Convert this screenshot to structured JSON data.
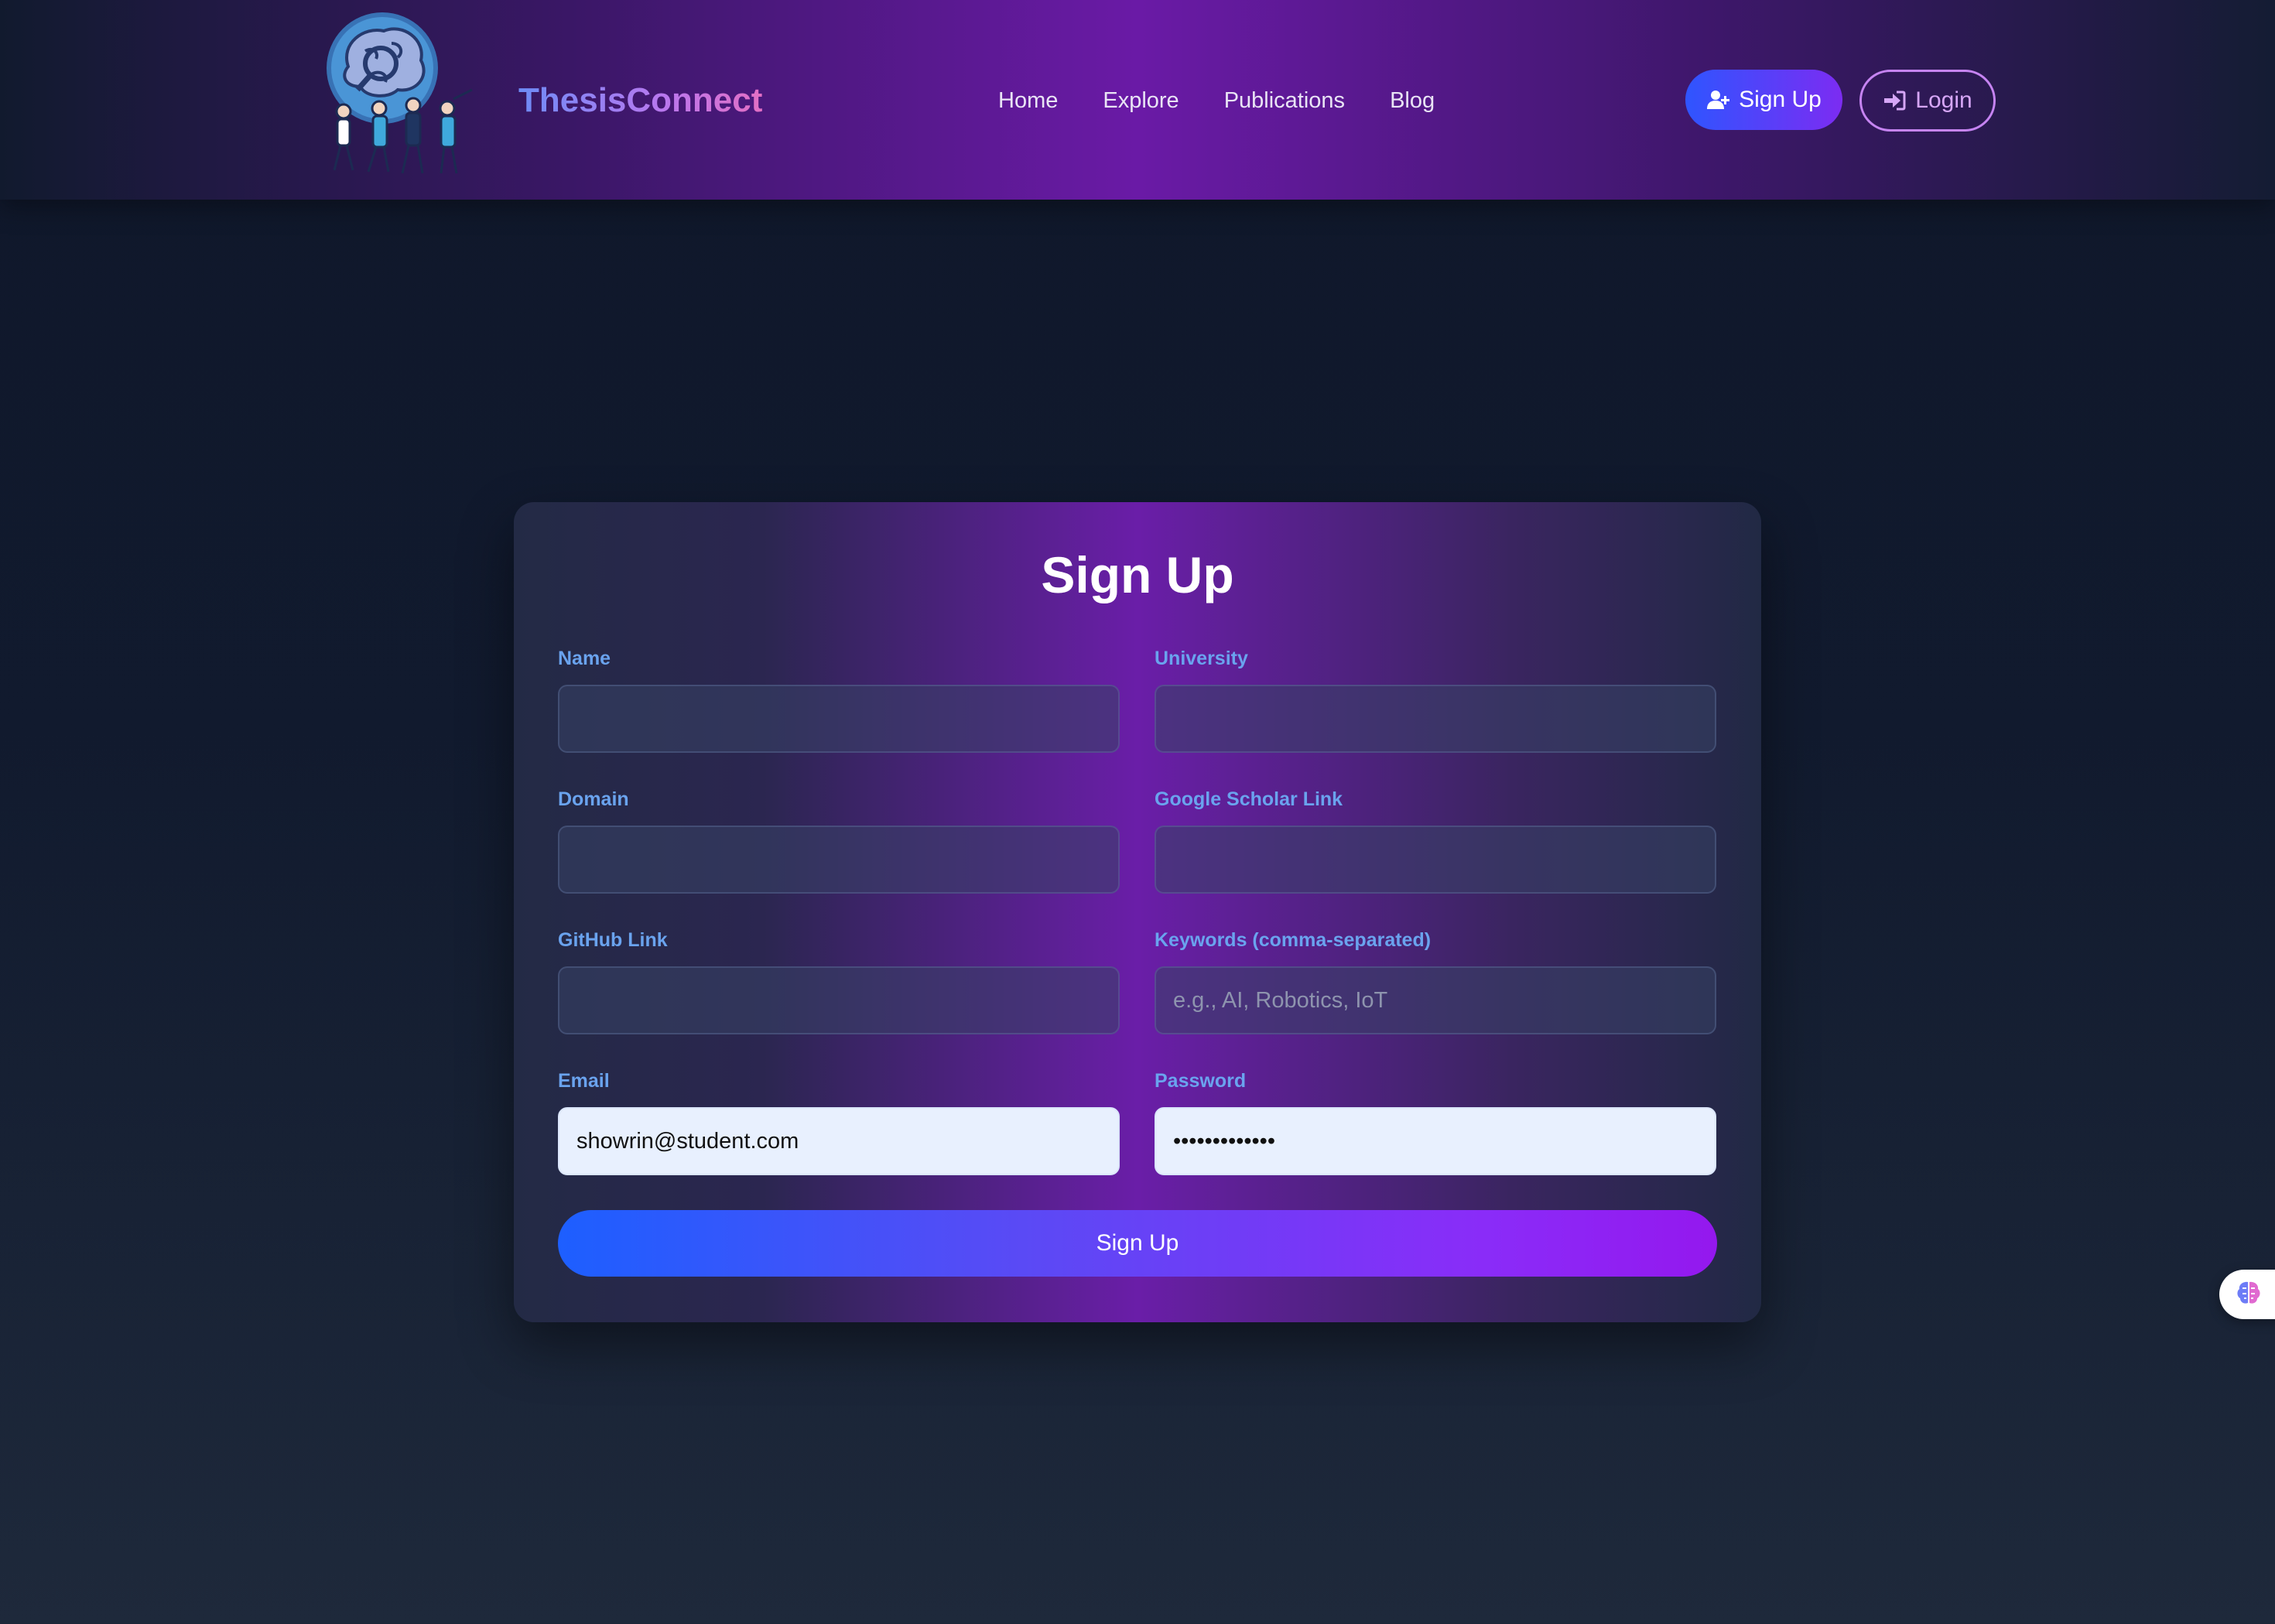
{
  "header": {
    "brand": "ThesisConnect",
    "nav": [
      "Home",
      "Explore",
      "Publications",
      "Blog"
    ],
    "signup_label": "Sign Up",
    "login_label": "Login"
  },
  "form": {
    "title": "Sign Up",
    "fields": [
      {
        "label": "Name",
        "value": "",
        "placeholder": ""
      },
      {
        "label": "University",
        "value": "",
        "placeholder": ""
      },
      {
        "label": "Domain",
        "value": "",
        "placeholder": ""
      },
      {
        "label": "Google Scholar Link",
        "value": "",
        "placeholder": ""
      },
      {
        "label": "GitHub Link",
        "value": "",
        "placeholder": ""
      },
      {
        "label": "Keywords (comma-separated)",
        "value": "",
        "placeholder": "e.g., AI, Robotics, IoT"
      },
      {
        "label": "Email",
        "value": "showrin@student.com",
        "placeholder": ""
      },
      {
        "label": "Password",
        "value": "•••••••••••••",
        "placeholder": ""
      }
    ],
    "submit_label": "Sign Up"
  },
  "icons": {
    "logo": "brain-researchers-logo",
    "signup": "user-plus-icon",
    "login": "sign-in-icon",
    "widget": "brain-icon"
  },
  "colors": {
    "background": "#0f172a",
    "accent_blue": "#2f55ff",
    "accent_purple": "#8a2cf8",
    "label": "#6aa3ee",
    "login_outline": "#c684f2"
  }
}
